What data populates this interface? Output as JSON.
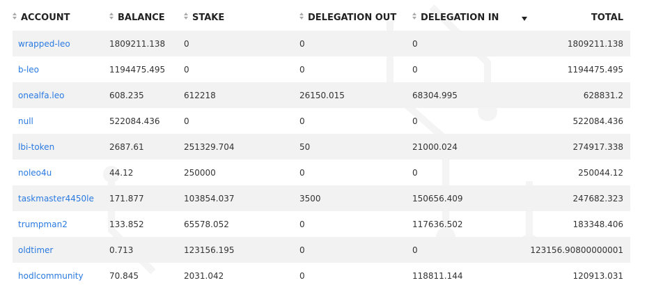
{
  "table": {
    "columns": [
      {
        "label": "ACCOUNT"
      },
      {
        "label": "BALANCE"
      },
      {
        "label": "STAKE"
      },
      {
        "label": "DELEGATION OUT"
      },
      {
        "label": "DELEGATION IN"
      },
      {
        "label": "TOTAL"
      }
    ],
    "sorted_column": "DELEGATION IN",
    "sort_direction": "descending",
    "rows": [
      {
        "account": "wrapped-leo",
        "balance": "1809211.138",
        "stake": "0",
        "delegation_out": "0",
        "delegation_in": "0",
        "total": "1809211.138"
      },
      {
        "account": "b-leo",
        "balance": "1194475.495",
        "stake": "0",
        "delegation_out": "0",
        "delegation_in": "0",
        "total": "1194475.495"
      },
      {
        "account": "onealfa.leo",
        "balance": "608.235",
        "stake": "612218",
        "delegation_out": "26150.015",
        "delegation_in": "68304.995",
        "total": "628831.2"
      },
      {
        "account": "null",
        "balance": "522084.436",
        "stake": "0",
        "delegation_out": "0",
        "delegation_in": "0",
        "total": "522084.436"
      },
      {
        "account": "lbi-token",
        "balance": "2687.61",
        "stake": "251329.704",
        "delegation_out": "50",
        "delegation_in": "21000.024",
        "total": "274917.338"
      },
      {
        "account": "noleo4u",
        "balance": "44.12",
        "stake": "250000",
        "delegation_out": "0",
        "delegation_in": "0",
        "total": "250044.12"
      },
      {
        "account": "taskmaster4450le",
        "balance": "171.877",
        "stake": "103854.037",
        "delegation_out": "3500",
        "delegation_in": "150656.409",
        "total": "247682.323"
      },
      {
        "account": "trumpman2",
        "balance": "133.852",
        "stake": "65578.052",
        "delegation_out": "0",
        "delegation_in": "117636.502",
        "total": "183348.406"
      },
      {
        "account": "oldtimer",
        "balance": "0.713",
        "stake": "123156.195",
        "delegation_out": "0",
        "delegation_in": "0",
        "total": "123156.90800000001"
      },
      {
        "account": "hodlcommunity",
        "balance": "70.845",
        "stake": "2031.042",
        "delegation_out": "0",
        "delegation_in": "118811.144",
        "total": "120913.031"
      }
    ]
  },
  "colors": {
    "link": "#2a7ae2",
    "stripe": "#f2f2f2",
    "text": "#333333",
    "sort_arrow": "#aaaaaa"
  },
  "icons": {
    "sort": "sort-arrows-icon",
    "sorted_desc": "sort-desc-icon"
  }
}
